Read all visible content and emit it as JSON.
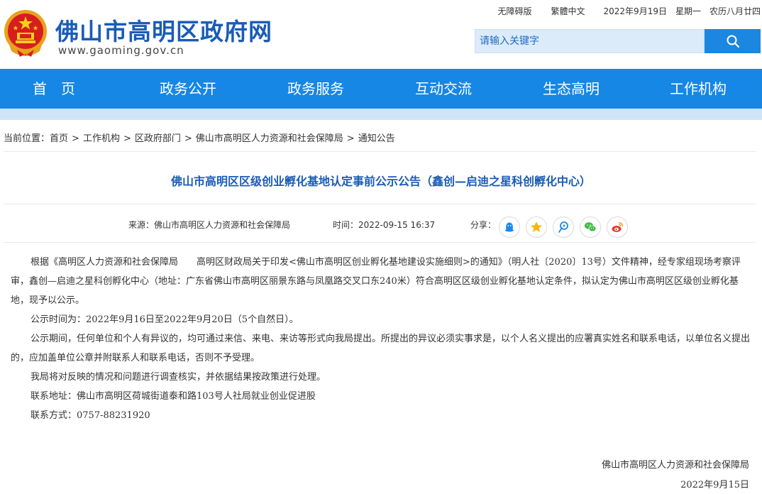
{
  "header": {
    "site_title": "佛山市高明区政府网",
    "site_url": "www.gaoming.gov.cn",
    "top_links": {
      "accessibility": "无障碍版",
      "traditional": "繁體中文",
      "date": "2022年9月19日",
      "weekday": "星期一",
      "lunar": "农历八月廿四"
    },
    "search": {
      "placeholder": "请输入关键字"
    }
  },
  "nav": {
    "items": [
      {
        "label": "首　页"
      },
      {
        "label": "政务公开"
      },
      {
        "label": "政务服务"
      },
      {
        "label": "互动交流"
      },
      {
        "label": "生态高明"
      },
      {
        "label": "工作机构"
      }
    ]
  },
  "breadcrumb": {
    "prefix": "当前位置：",
    "items": [
      "首页",
      "工作机构",
      "区政府部门",
      "佛山市高明区人力资源和社会保障局",
      "通知公告"
    ],
    "separator": ">"
  },
  "article": {
    "title": "佛山市高明区区级创业孵化基地认定事前公示公告（鑫创—启迪之星科创孵化中心）",
    "source": "来源：佛山市高明区人力资源和社会保障局",
    "time": "时间：2022-09-15 16:37",
    "share_label": "分享：",
    "share_icons": [
      "qq-icon",
      "qzone-star-icon",
      "tencent-weibo-icon",
      "wechat-icon",
      "sina-weibo-icon"
    ],
    "paragraphs": [
      "根据《高明区人力资源和社会保障局　　高明区财政局关于印发<佛山市高明区创业孵化基地建设实施细则>的通知》（明人社〔2020〕13号）文件精神，经专家组现场考察评审，鑫创—启迪之星科创孵化中心（地址：广东省佛山市高明区丽景东路与凤凰路交叉口东240米）符合高明区区级创业孵化基地认定条件，拟认定为佛山市高明区区级创业孵化基地，现予以公示。",
      "公示时间为：2022年9月16日至2022年9月20日（5个自然日）。",
      "公示期间，任何单位和个人有异议的，均可通过来信、来电、来访等形式向我局提出。所提出的异议必须实事求是，以个人名义提出的应署真实姓名和联系电话，以单位名义提出的，应加盖单位公章并附联系人和联系电话，否则不予受理。",
      "我局将对反映的情况和问题进行调查核实，并依据结果按政策进行处理。",
      "联系地址：佛山市高明区荷城街道泰和路103号人社局就业创业促进股",
      "联系方式：0757-88231920"
    ],
    "signoff": "佛山市高明区人力资源和社会保障局",
    "sign_date": "2022年9月15日"
  },
  "colors": {
    "brand_blue": "#1a5cb6",
    "nav_blue": "#1687e5",
    "nav_sub": "#cfe5f7",
    "search_bg": "#dcebf9",
    "search_button": "#1b87e0"
  }
}
